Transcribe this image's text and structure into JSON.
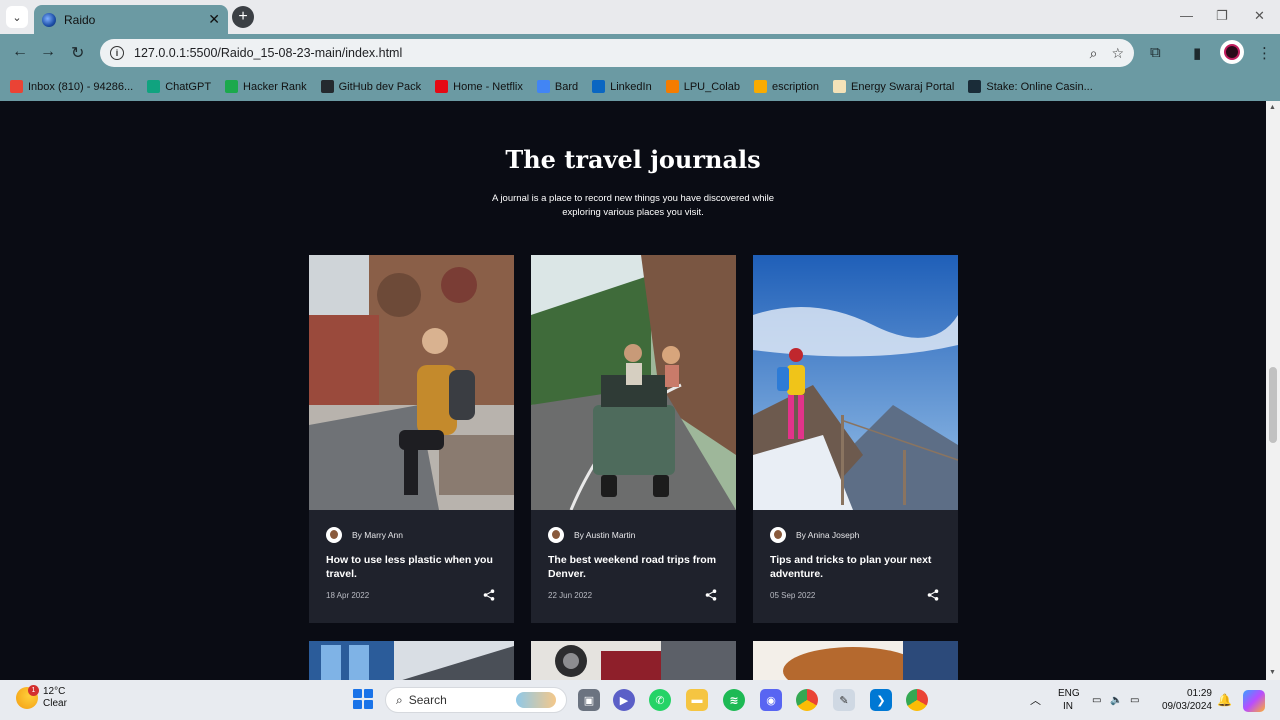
{
  "browser": {
    "tab_title": "Raido",
    "url": "127.0.0.1:5500/Raido_15-08-23-main/index.html",
    "bookmarks": [
      {
        "label": "Inbox (810) - 94286...",
        "color": "#ea4335"
      },
      {
        "label": "ChatGPT",
        "color": "#10a37f"
      },
      {
        "label": "Hacker Rank",
        "color": "#1ba94c"
      },
      {
        "label": "GitHub dev Pack",
        "color": "#24292e"
      },
      {
        "label": "Home - Netflix",
        "color": "#e50914"
      },
      {
        "label": "Bard",
        "color": "#4285f4"
      },
      {
        "label": "LinkedIn",
        "color": "#0a66c2"
      },
      {
        "label": "LPU_Colab",
        "color": "#f57c00"
      },
      {
        "label": "escription",
        "color": "#f9ab00"
      },
      {
        "label": "Energy Swaraj Portal",
        "color": "#f4e2b8"
      },
      {
        "label": "Stake: Online Casin...",
        "color": "#1a2c38"
      }
    ]
  },
  "section": {
    "title": "The travel journals",
    "subtitle": "A journal is a place to record new things you have discovered while exploring various places you visit."
  },
  "cards": [
    {
      "author": "By Marry Ann",
      "title": "How to use less plastic when you travel.",
      "date": "18 Apr 2022"
    },
    {
      "author": "By Austin Martin",
      "title": "The best weekend road trips from Denver.",
      "date": "22 Jun 2022"
    },
    {
      "author": "By Anina Joseph",
      "title": "Tips and tricks to plan your next adventure.",
      "date": "05 Sep 2022"
    }
  ],
  "taskbar": {
    "weather_temp": "12°C",
    "weather_desc": "Clear",
    "weather_badge": "1",
    "search_label": "Search",
    "lang_line1": "ENG",
    "lang_line2": "IN",
    "time": "01:29",
    "date": "09/03/2024"
  }
}
